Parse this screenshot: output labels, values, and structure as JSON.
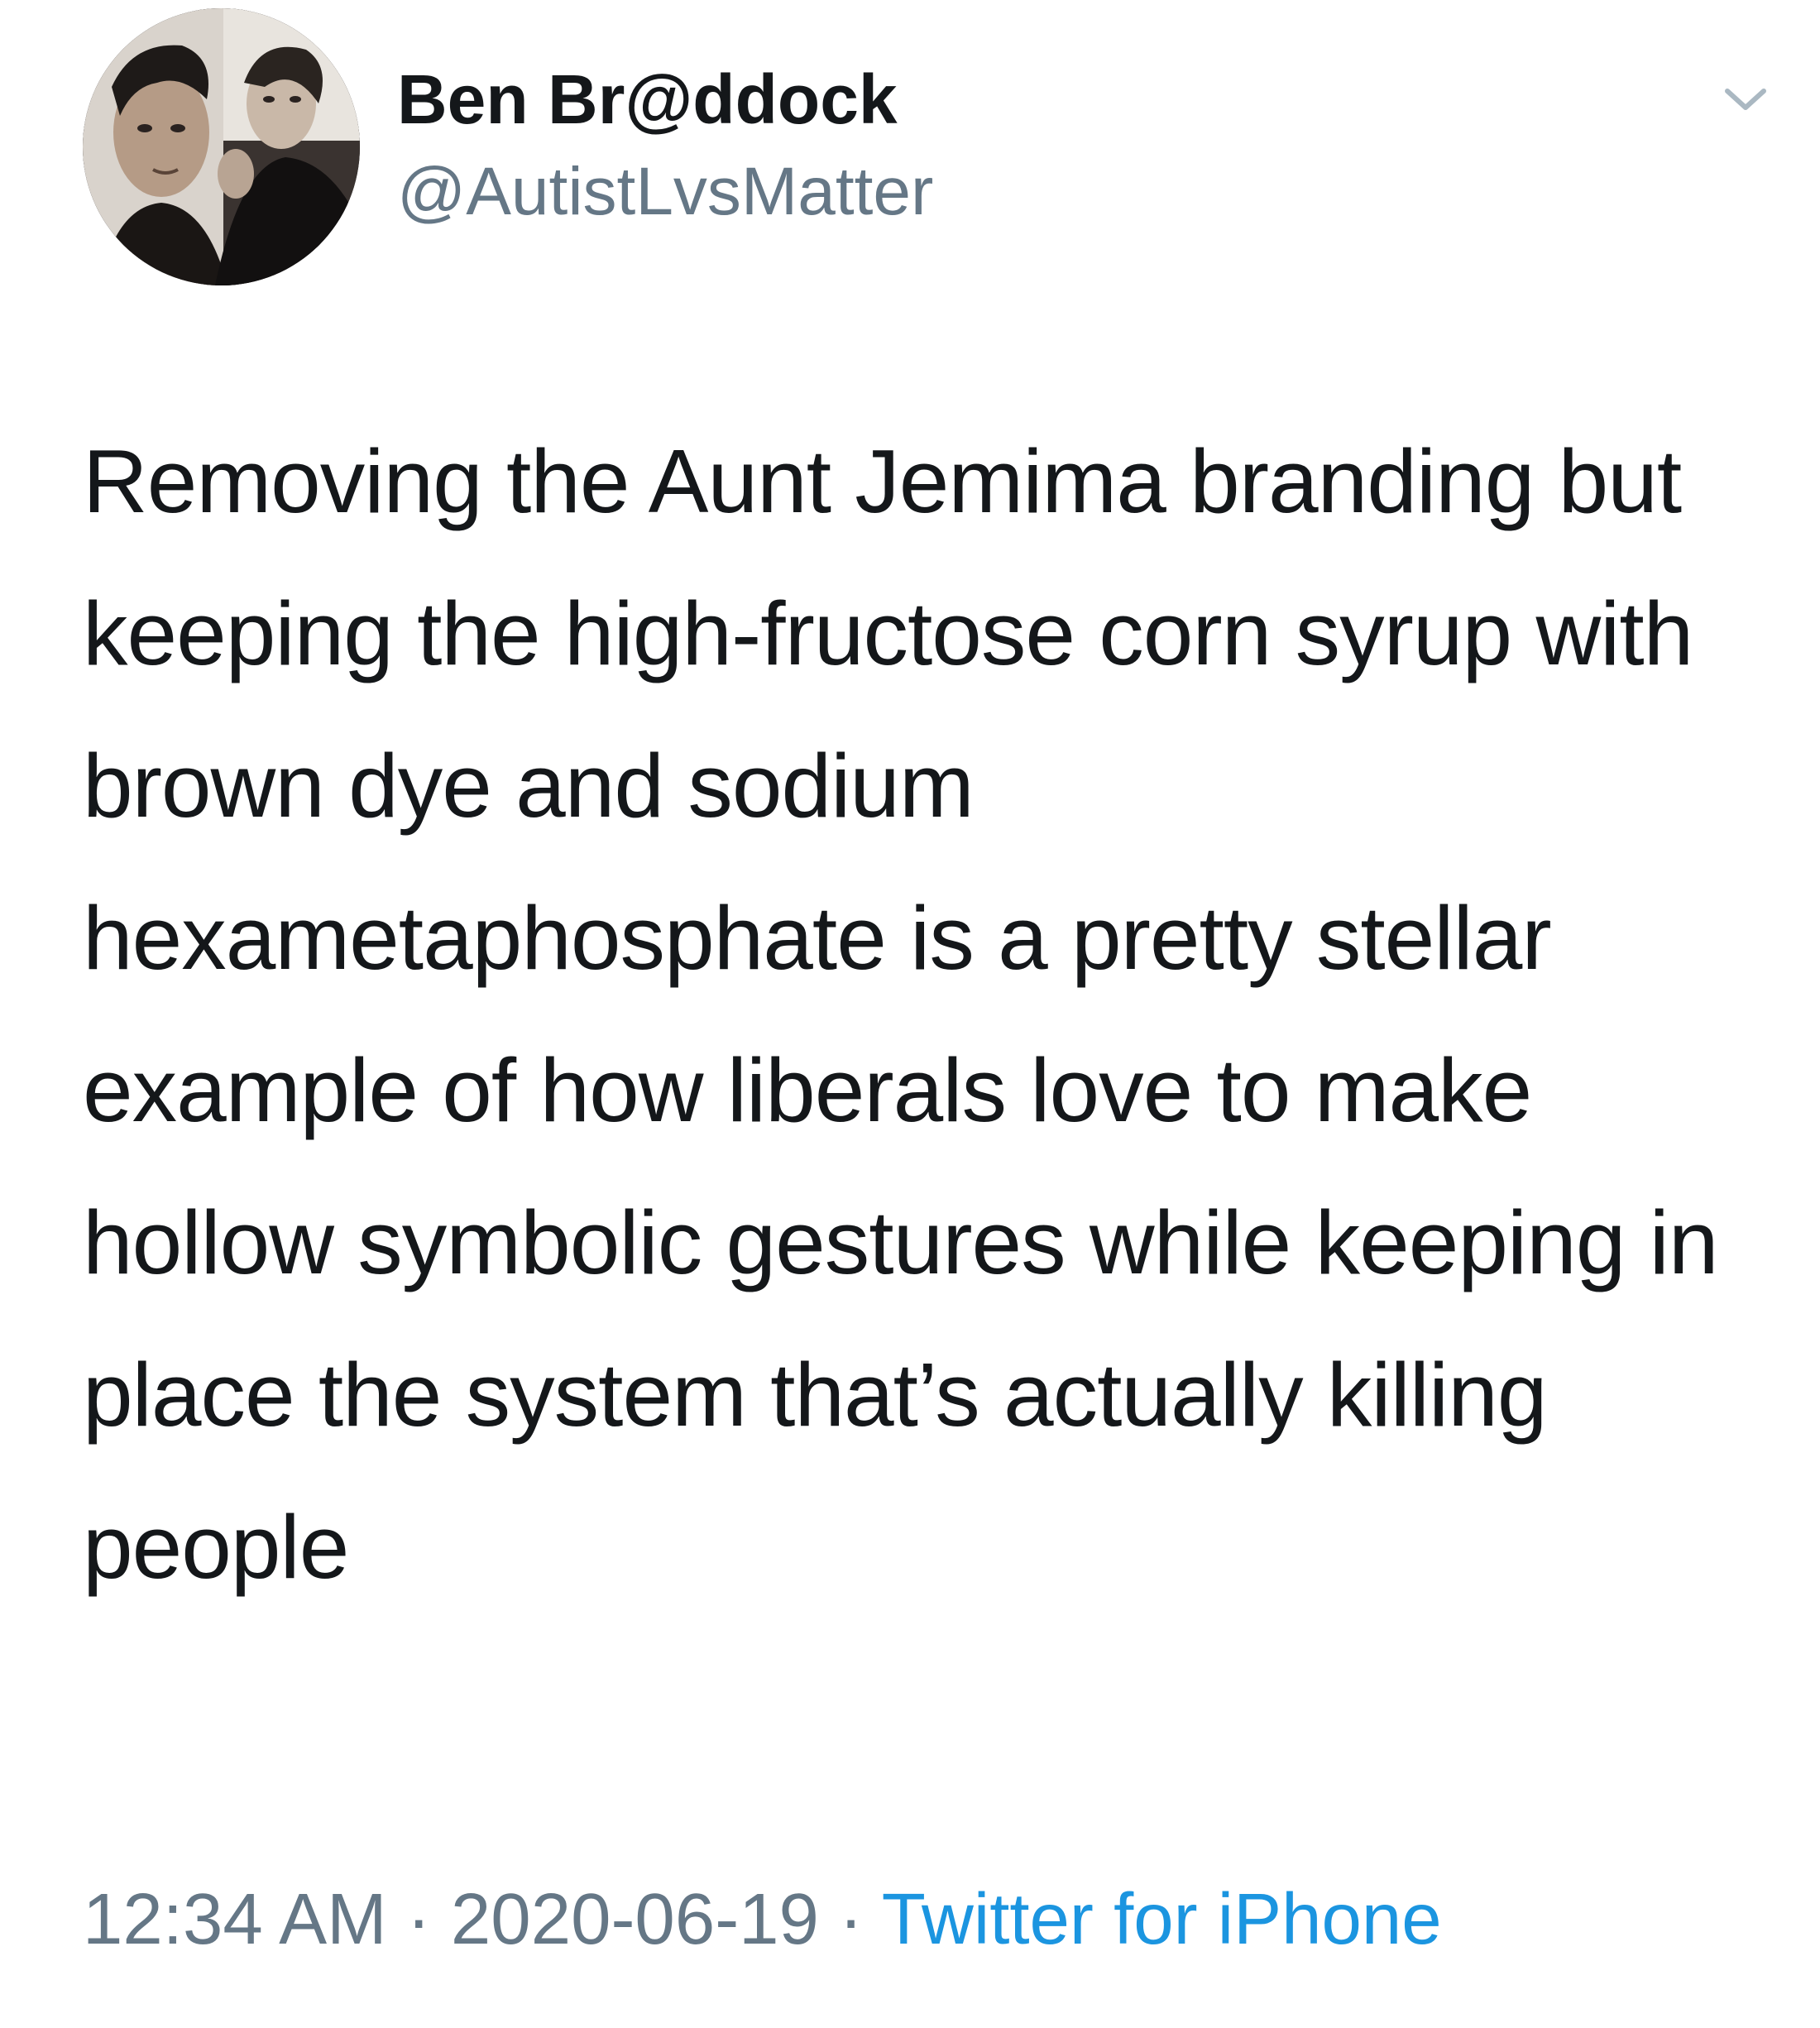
{
  "tweet": {
    "author": {
      "display_name": "Ben Br@ddock",
      "handle": "@AutistLvsMatter"
    },
    "text": "Removing the Aunt Jemima branding but keeping the high-fructose corn syrup with brown dye and sodium hexametaphosphate is a pretty stellar example of how liberals love to make hollow symbolic gestures while keeping in place the system that’s actually killing people",
    "time": "12:34 AM",
    "separator": " · ",
    "date": "2020-06-19",
    "source": "Twitter for iPhone"
  },
  "icons": {
    "menu": "chevron-down-icon"
  },
  "colors": {
    "text": "#14171a",
    "secondary": "#657786",
    "link": "#1b95e0",
    "background": "#ffffff"
  }
}
